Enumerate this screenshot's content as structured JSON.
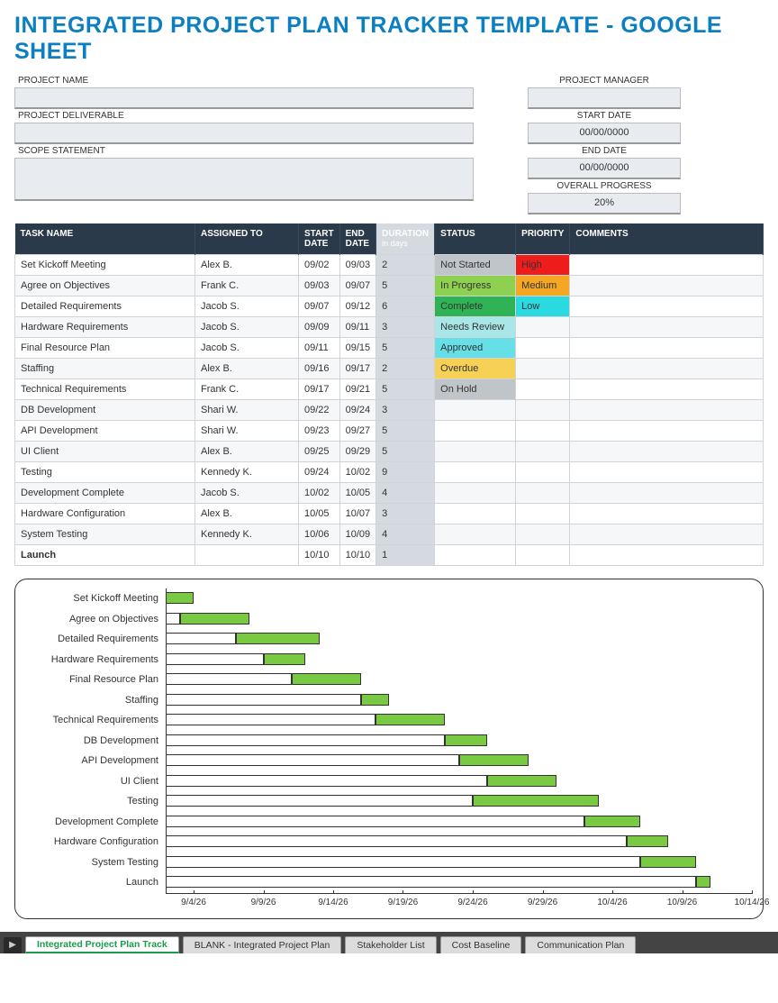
{
  "title": "INTEGRATED PROJECT PLAN TRACKER TEMPLATE - GOOGLE SHEET",
  "fields": {
    "project_name_label": "PROJECT NAME",
    "project_name": "",
    "project_deliverable_label": "PROJECT DELIVERABLE",
    "project_deliverable": "",
    "scope_statement_label": "SCOPE STATEMENT",
    "scope_statement": "",
    "project_manager_label": "PROJECT MANAGER",
    "project_manager": "",
    "start_date_label": "START DATE",
    "start_date": "00/00/0000",
    "end_date_label": "END DATE",
    "end_date": "00/00/0000",
    "overall_progress_label": "OVERALL PROGRESS",
    "overall_progress": "20%"
  },
  "table": {
    "headers": {
      "task": "TASK NAME",
      "assigned": "ASSIGNED TO",
      "start": "START DATE",
      "end": "END DATE",
      "duration": "DURATION",
      "duration_sub": "in days",
      "status": "STATUS",
      "priority": "PRIORITY",
      "comments": "COMMENTS"
    },
    "rows": [
      {
        "task": "Set Kickoff Meeting",
        "assigned": "Alex B.",
        "start": "09/02",
        "end": "09/03",
        "duration": "2",
        "status": "Not Started",
        "status_color": "#c0c5ca",
        "priority": "High",
        "priority_color": "#ef1c1c"
      },
      {
        "task": "Agree on Objectives",
        "assigned": "Frank C.",
        "start": "09/03",
        "end": "09/07",
        "duration": "5",
        "status": "In Progress",
        "status_color": "#8ed04f",
        "priority": "Medium",
        "priority_color": "#f5a623"
      },
      {
        "task": "Detailed Requirements",
        "assigned": "Jacob S.",
        "start": "09/07",
        "end": "09/12",
        "duration": "6",
        "status": "Complete",
        "status_color": "#2eb455",
        "priority": "Low",
        "priority_color": "#2bd9e0"
      },
      {
        "task": "Hardware Requirements",
        "assigned": "Jacob S.",
        "start": "09/09",
        "end": "09/11",
        "duration": "3",
        "status": "Needs Review",
        "status_color": "#a9e6e8",
        "priority": "",
        "priority_color": ""
      },
      {
        "task": "Final Resource Plan",
        "assigned": "Jacob S.",
        "start": "09/11",
        "end": "09/15",
        "duration": "5",
        "status": "Approved",
        "status_color": "#66e0e6",
        "priority": "",
        "priority_color": ""
      },
      {
        "task": "Staffing",
        "assigned": "Alex B.",
        "start": "09/16",
        "end": "09/17",
        "duration": "2",
        "status": "Overdue",
        "status_color": "#f6d155",
        "priority": "",
        "priority_color": ""
      },
      {
        "task": "Technical Requirements",
        "assigned": "Frank C.",
        "start": "09/17",
        "end": "09/21",
        "duration": "5",
        "status": "On Hold",
        "status_color": "#c0c5ca",
        "priority": "",
        "priority_color": ""
      },
      {
        "task": "DB Development",
        "assigned": "Shari W.",
        "start": "09/22",
        "end": "09/24",
        "duration": "3",
        "status": "",
        "status_color": "",
        "priority": "",
        "priority_color": ""
      },
      {
        "task": "API Development",
        "assigned": "Shari W.",
        "start": "09/23",
        "end": "09/27",
        "duration": "5",
        "status": "",
        "status_color": "",
        "priority": "",
        "priority_color": ""
      },
      {
        "task": "UI Client",
        "assigned": "Alex B.",
        "start": "09/25",
        "end": "09/29",
        "duration": "5",
        "status": "",
        "status_color": "",
        "priority": "",
        "priority_color": ""
      },
      {
        "task": "Testing",
        "assigned": "Kennedy K.",
        "start": "09/24",
        "end": "10/02",
        "duration": "9",
        "status": "",
        "status_color": "",
        "priority": "",
        "priority_color": ""
      },
      {
        "task": "Development Complete",
        "assigned": "Jacob S.",
        "start": "10/02",
        "end": "10/05",
        "duration": "4",
        "status": "",
        "status_color": "",
        "priority": "",
        "priority_color": ""
      },
      {
        "task": "Hardware Configuration",
        "assigned": "Alex B.",
        "start": "10/05",
        "end": "10/07",
        "duration": "3",
        "status": "",
        "status_color": "",
        "priority": "",
        "priority_color": ""
      },
      {
        "task": "System Testing",
        "assigned": "Kennedy K.",
        "start": "10/06",
        "end": "10/09",
        "duration": "4",
        "status": "",
        "status_color": "",
        "priority": "",
        "priority_color": ""
      },
      {
        "task": "Launch",
        "assigned": "",
        "start": "10/10",
        "end": "10/10",
        "duration": "1",
        "status": "",
        "status_color": "",
        "priority": "",
        "priority_color": "",
        "bold": true
      }
    ]
  },
  "chart_data": {
    "type": "bar",
    "orientation": "horizontal-stacked-gantt",
    "x_axis_type": "date",
    "x_min": "9/2/26",
    "x_max": "10/14/26",
    "x_ticks": [
      "9/4/26",
      "9/9/26",
      "9/14/26",
      "9/19/26",
      "9/24/26",
      "9/29/26",
      "10/4/26",
      "10/9/26",
      "10/14/26"
    ],
    "categories": [
      "Set Kickoff Meeting",
      "Agree on Objectives",
      "Detailed Requirements",
      "Hardware Requirements",
      "Final Resource Plan",
      "Staffing",
      "Technical Requirements",
      "DB Development",
      "API Development",
      "UI Client",
      "Testing",
      "Development Complete",
      "Hardware Configuration",
      "System Testing",
      "Launch"
    ],
    "series": [
      {
        "name": "offset_days_from_9_2",
        "values": [
          0,
          1,
          5,
          7,
          9,
          14,
          15,
          20,
          21,
          23,
          22,
          30,
          33,
          34,
          38
        ],
        "fill": "white"
      },
      {
        "name": "duration_days",
        "values": [
          2,
          5,
          6,
          3,
          5,
          2,
          5,
          3,
          5,
          5,
          9,
          4,
          3,
          4,
          1
        ],
        "fill": "#7ac943"
      }
    ],
    "bars": [
      {
        "task": "Set Kickoff Meeting",
        "start": "9/2/26",
        "end": "9/3/26",
        "offset_days": 0,
        "duration_days": 2
      },
      {
        "task": "Agree on Objectives",
        "start": "9/3/26",
        "end": "9/7/26",
        "offset_days": 1,
        "duration_days": 5
      },
      {
        "task": "Detailed Requirements",
        "start": "9/7/26",
        "end": "9/12/26",
        "offset_days": 5,
        "duration_days": 6
      },
      {
        "task": "Hardware Requirements",
        "start": "9/9/26",
        "end": "9/11/26",
        "offset_days": 7,
        "duration_days": 3
      },
      {
        "task": "Final Resource Plan",
        "start": "9/11/26",
        "end": "9/15/26",
        "offset_days": 9,
        "duration_days": 5
      },
      {
        "task": "Staffing",
        "start": "9/16/26",
        "end": "9/17/26",
        "offset_days": 14,
        "duration_days": 2
      },
      {
        "task": "Technical Requirements",
        "start": "9/17/26",
        "end": "9/21/26",
        "offset_days": 15,
        "duration_days": 5
      },
      {
        "task": "DB Development",
        "start": "9/22/26",
        "end": "9/24/26",
        "offset_days": 20,
        "duration_days": 3
      },
      {
        "task": "API Development",
        "start": "9/23/26",
        "end": "9/27/26",
        "offset_days": 21,
        "duration_days": 5
      },
      {
        "task": "UI Client",
        "start": "9/25/26",
        "end": "9/29/26",
        "offset_days": 23,
        "duration_days": 5
      },
      {
        "task": "Testing",
        "start": "9/24/26",
        "end": "10/2/26",
        "offset_days": 22,
        "duration_days": 9
      },
      {
        "task": "Development Complete",
        "start": "10/2/26",
        "end": "10/5/26",
        "offset_days": 30,
        "duration_days": 4
      },
      {
        "task": "Hardware Configuration",
        "start": "10/5/26",
        "end": "10/7/26",
        "offset_days": 33,
        "duration_days": 3
      },
      {
        "task": "System Testing",
        "start": "10/6/26",
        "end": "10/9/26",
        "offset_days": 34,
        "duration_days": 4
      },
      {
        "task": "Launch",
        "start": "10/10/26",
        "end": "10/10/26",
        "offset_days": 38,
        "duration_days": 1
      }
    ],
    "total_days_span": 42
  },
  "sheet_tabs": {
    "active": "Integrated Project Plan Track",
    "tabs": [
      "Integrated Project Plan Track",
      "BLANK - Integrated Project Plan",
      "Stakeholder List",
      "Cost Baseline",
      "Communication Plan"
    ]
  }
}
